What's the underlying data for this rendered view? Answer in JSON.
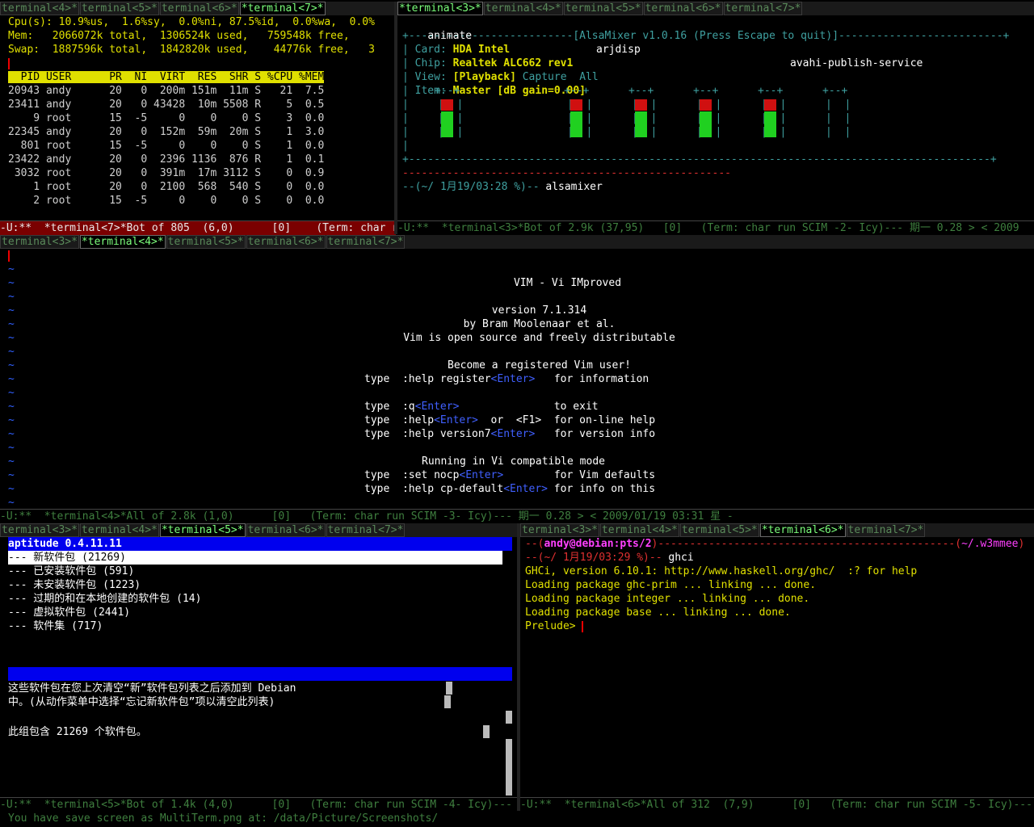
{
  "top_left": {
    "tabs": [
      "terminal<4>*",
      "terminal<5>*",
      "terminal<6>*",
      "*terminal<7>*"
    ],
    "active_tab": 3,
    "summary": [
      "Cpu(s): 10.9%us,  1.6%sy,  0.0%ni, 87.5%id,  0.0%wa,  0.0%",
      "Mem:   2066072k total,  1306524k used,   759548k free,",
      "Swap:  1887596k total,  1842820k used,    44776k free,   3"
    ],
    "table_header": "  PID USER      PR  NI  VIRT  RES  SHR S %CPU %MEM",
    "processes": [
      "20943 andy      20   0  200m 151m  11m S   21  7.5",
      "23411 andy      20   0 43428  10m 5508 R    5  0.5",
      "    9 root      15  -5     0    0    0 S    3  0.0",
      "22345 andy      20   0  152m  59m  20m S    1  3.0",
      "  801 root      15  -5     0    0    0 S    1  0.0",
      "23422 andy      20   0  2396 1136  876 R    1  0.1",
      " 3032 root      20   0  391m  17m 3112 S    0  0.9",
      "    1 root      20   0  2100  568  540 S    0  0.0",
      "    2 root      15  -5     0    0    0 S    0  0.0"
    ],
    "modeline": "-U:**  *terminal<7>*Bot of 805  (6,0)      [0]    (Term: char r"
  },
  "top_right": {
    "tabs": [
      "*terminal<3>*",
      "terminal<4>*",
      "terminal<5>*",
      "terminal<6>*",
      "terminal<7>*"
    ],
    "active_tab": 0,
    "header_items": [
      "animate",
      "arjdisp",
      "avahi-publish-service"
    ],
    "title_line": "+--------------------------[AlsaMixer v1.0.16 (Press Escape to quit)]--------------------------+",
    "card_label": "Card:",
    "card_value": "HDA Intel",
    "chip_label": "Chip:",
    "chip_value": "Realtek ALC662 rev1",
    "view_label": "View:",
    "view_playback": "[Playback]",
    "view_capture": "Capture",
    "view_all": "All",
    "item_label": "Item:",
    "item_value": "Master [dB gain=0.00]",
    "channel_levels": [
      0.72,
      0.72,
      0.72,
      0.72,
      0.72,
      0.0
    ],
    "prompt_user": "--(~/ 1月19/03:28 %)-- ",
    "prompt_cmd": "alsamixer",
    "modeline": "-U:**  *terminal<3>*Bot of 2.9k (37,95)   [0]   (Term: char run SCIM -2- Icy)--- 期一 0.28 > < 2009"
  },
  "middle": {
    "tabs": [
      "terminal<3>*",
      "*terminal<4>*",
      "terminal<5>*",
      "terminal<6>*",
      "terminal<7>*"
    ],
    "active_tab": 1,
    "vim_title": "VIM - Vi IMproved",
    "vim_version": "version 7.1.314",
    "vim_author": "by Bram Moolenaar et al.",
    "vim_license": "Vim is open source and freely distributable",
    "vim_register": "Become a registered Vim user!",
    "cmds": [
      {
        "pre": "type  :help register",
        "key": "<Enter>",
        "post": "   for information"
      },
      {
        "pre": "",
        "key": "",
        "post": ""
      },
      {
        "pre": "type  :q",
        "key": "<Enter>",
        "post": "               to exit"
      },
      {
        "pre": "type  :help",
        "key": "<Enter>",
        "post": "  or  <F1>  for on-line help"
      },
      {
        "pre": "type  :help version7",
        "key": "<Enter>",
        "post": "   for version info"
      }
    ],
    "vi_compat": "Running in Vi compatible mode",
    "cmds2": [
      {
        "pre": "type  :set nocp",
        "key": "<Enter>",
        "post": "        for Vim defaults"
      },
      {
        "pre": "type  :help cp-default",
        "key": "<Enter>",
        "post": " for info on this"
      }
    ],
    "modeline": "-U:**  *terminal<4>*All of 2.8k (1,0)      [0]   (Term: char run SCIM -3- Icy)--- 期一 0.28 > < 2009/01/19 03:31 星 -"
  },
  "bottom_left": {
    "tabs": [
      "terminal<3>*",
      "terminal<4>*",
      "*terminal<5>*",
      "terminal<6>*",
      "terminal<7>*"
    ],
    "active_tab": 2,
    "app_title": "aptitude 0.4.11.11",
    "packages": [
      "--- 新软件包 (21269)",
      "--- 已安装软件包 (591)",
      "--- 未安装软件包 (1223)",
      "--- 过期的和在本地创建的软件包 (14)",
      "--- 虚拟软件包 (2441)",
      "--- 软件集 (717)"
    ],
    "desc_line1": "这些软件包在您上次清空“新”软件包列表之后添加到 Debian",
    "desc_line2": "中。(从动作菜单中选择“忘记新软件包”项以清空此列表)",
    "desc_line3": "此组包含 21269 个软件包。",
    "modeline": "-U:**  *terminal<5>*Bot of 1.4k (4,0)      [0]   (Term: char run SCIM -4- Icy)---"
  },
  "bottom_right": {
    "tabs": [
      "terminal<3>*",
      "terminal<4>*",
      "terminal<5>*",
      "*terminal<6>*",
      "terminal<7>*"
    ],
    "active_tab": 3,
    "user_host": "andy@debian:pts/2",
    "cwd": "~/.w3mmee",
    "prompt": "--(~/ 1月19/03:29 %)-- ",
    "command": "ghci",
    "output": [
      "GHCi, version 6.10.1: http://www.haskell.org/ghc/  :? for help",
      "Loading package ghc-prim ... linking ... done.",
      "Loading package integer ... linking ... done.",
      "Loading package base ... linking ... done."
    ],
    "repl_prompt": "Prelude> ",
    "modeline": "-U:**  *terminal<6>*All of 312  (7,9)      [0]   (Term: char run SCIM -5- Icy)---"
  },
  "echo_area": "You have save screen as MultiTerm.png at: /data/Picture/Screenshots/",
  "colors": {
    "accent_green": "#7cff7c",
    "modeline_active": "#7a0000",
    "aptitude_blue": "#0000ee"
  }
}
